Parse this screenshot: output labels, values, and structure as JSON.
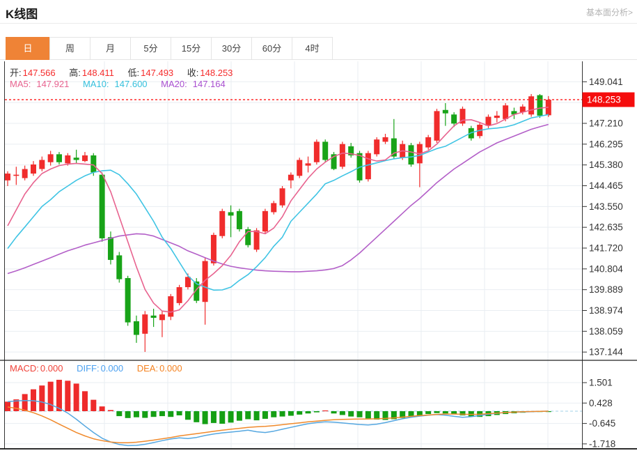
{
  "header": {
    "title": "K线图",
    "link_label": "基本面分析>"
  },
  "tabs": {
    "items": [
      {
        "key": "day",
        "label": "日",
        "active": true
      },
      {
        "key": "week",
        "label": "周",
        "active": false
      },
      {
        "key": "month",
        "label": "月",
        "active": false
      },
      {
        "key": "5min",
        "label": "5分",
        "active": false
      },
      {
        "key": "15min",
        "label": "15分",
        "active": false
      },
      {
        "key": "30min",
        "label": "30分",
        "active": false
      },
      {
        "key": "60min",
        "label": "60分",
        "active": false
      },
      {
        "key": "4hour",
        "label": "4时",
        "active": false
      }
    ]
  },
  "legend": {
    "open_label": "开:",
    "open": "147.566",
    "high_label": "高:",
    "high": "148.411",
    "low_label": "低:",
    "low": "147.493",
    "close_label": "收:",
    "close": "148.253",
    "ma5_label": "MA5:",
    "ma5": "147.921",
    "ma10_label": "MA10:",
    "ma10": "147.600",
    "ma20_label": "MA20:",
    "ma20": "147.164",
    "macd_label": "MACD:",
    "macd": "0.000",
    "diff_label": "DIFF:",
    "diff": "0.000",
    "dea_label": "DEA:",
    "dea": "0.000"
  },
  "colors": {
    "up": "#f02c2c",
    "down": "#18a318",
    "ma5": "#e8638f",
    "ma10": "#3fc4e4",
    "ma20": "#b35fc8",
    "hist_up": "#ee2b2b",
    "hist_down": "#149f14",
    "diff_line": "#55a7e0",
    "dea_line": "#f08a2c",
    "price_line": "#ff2a2a",
    "price_box_bg": "#f50d0d",
    "price_box_text": "#ffffff",
    "grid": "#e9eef2",
    "axis_line": "#333333",
    "axis_text": "#333333",
    "macd_zero": "#b5d9ec",
    "tab_active_bg": "#ef8336"
  },
  "chart_data": [
    {
      "type": "candlestick",
      "pane": "price",
      "ylim": [
        136.9,
        149.35
      ],
      "y_tick_labels": [
        "149.041",
        "147.210",
        "146.295",
        "145.380",
        "144.465",
        "143.550",
        "142.635",
        "141.720",
        "140.804",
        "139.889",
        "138.974",
        "138.059",
        "137.144"
      ],
      "y_grid_extra": [
        148.126
      ],
      "current_price": 148.253,
      "current_price_label": "148.253",
      "candles_format": [
        "open",
        "high",
        "low",
        "close"
      ],
      "candles": [
        [
          144.7,
          145.1,
          144.45,
          145.0
        ],
        [
          144.9,
          145.3,
          144.5,
          144.95
        ],
        [
          144.8,
          145.35,
          144.7,
          145.2
        ],
        [
          145.0,
          145.55,
          144.9,
          145.4
        ],
        [
          145.2,
          145.75,
          145.1,
          145.6
        ],
        [
          145.5,
          146.0,
          145.35,
          145.85
        ],
        [
          145.85,
          145.95,
          145.4,
          145.5
        ],
        [
          145.45,
          145.9,
          145.35,
          145.8
        ],
        [
          145.7,
          146.05,
          145.45,
          145.6
        ],
        [
          145.55,
          145.95,
          145.5,
          145.8
        ],
        [
          145.8,
          145.9,
          144.9,
          145.05
        ],
        [
          144.95,
          145.05,
          142.0,
          142.15
        ],
        [
          142.2,
          142.45,
          141.0,
          141.2
        ],
        [
          141.4,
          141.55,
          140.2,
          140.35
        ],
        [
          140.4,
          140.5,
          138.3,
          138.45
        ],
        [
          138.5,
          138.75,
          137.55,
          137.9
        ],
        [
          137.95,
          138.95,
          137.15,
          138.8
        ],
        [
          138.75,
          139.05,
          138.25,
          138.65
        ],
        [
          138.55,
          138.95,
          137.8,
          138.8
        ],
        [
          138.7,
          139.7,
          138.55,
          139.6
        ],
        [
          139.3,
          140.1,
          139.2,
          140.0
        ],
        [
          140.0,
          140.6,
          139.9,
          140.45
        ],
        [
          140.25,
          140.4,
          139.3,
          139.4
        ],
        [
          139.35,
          141.3,
          138.35,
          141.15
        ],
        [
          141.05,
          142.4,
          140.95,
          142.3
        ],
        [
          142.25,
          143.45,
          142.15,
          143.35
        ],
        [
          143.3,
          143.6,
          142.2,
          143.15
        ],
        [
          143.35,
          143.45,
          142.45,
          142.55
        ],
        [
          142.55,
          142.65,
          141.75,
          141.85
        ],
        [
          141.65,
          142.6,
          141.55,
          142.5
        ],
        [
          142.45,
          143.45,
          142.35,
          143.35
        ],
        [
          143.3,
          143.8,
          143.2,
          143.7
        ],
        [
          143.6,
          144.45,
          143.5,
          144.35
        ],
        [
          144.7,
          145.05,
          144.35,
          144.95
        ],
        [
          144.9,
          145.7,
          144.8,
          145.6
        ],
        [
          145.35,
          145.75,
          145.05,
          145.45
        ],
        [
          145.5,
          146.5,
          145.4,
          146.4
        ],
        [
          146.4,
          146.5,
          145.5,
          145.6
        ],
        [
          145.85,
          145.95,
          145.15,
          145.2
        ],
        [
          145.3,
          146.4,
          145.2,
          146.3
        ],
        [
          146.2,
          146.35,
          145.7,
          145.8
        ],
        [
          145.9,
          146.0,
          144.6,
          144.7
        ],
        [
          144.75,
          146.0,
          144.65,
          145.9
        ],
        [
          145.85,
          146.6,
          145.75,
          146.5
        ],
        [
          146.4,
          146.75,
          146.3,
          146.6
        ],
        [
          146.55,
          147.4,
          145.65,
          145.75
        ],
        [
          145.7,
          146.45,
          145.6,
          146.3
        ],
        [
          146.25,
          146.35,
          145.3,
          145.4
        ],
        [
          145.45,
          146.4,
          144.4,
          146.3
        ],
        [
          146.15,
          146.7,
          146.05,
          146.6
        ],
        [
          146.45,
          147.85,
          146.35,
          147.75
        ],
        [
          147.8,
          148.1,
          147.1,
          147.65
        ],
        [
          147.6,
          147.7,
          147.05,
          147.2
        ],
        [
          147.2,
          147.95,
          147.1,
          147.85
        ],
        [
          147.0,
          147.1,
          146.45,
          146.55
        ],
        [
          146.65,
          147.25,
          146.55,
          147.15
        ],
        [
          147.1,
          147.6,
          147.0,
          147.5
        ],
        [
          147.45,
          147.75,
          147.25,
          147.55
        ],
        [
          147.4,
          148.1,
          147.3,
          148.0
        ],
        [
          147.75,
          147.9,
          147.4,
          147.6
        ],
        [
          147.7,
          148.05,
          147.6,
          147.95
        ],
        [
          147.6,
          148.5,
          147.5,
          148.4
        ],
        [
          148.45,
          148.5,
          147.45,
          147.55
        ],
        [
          147.566,
          148.411,
          147.493,
          148.253
        ]
      ],
      "series": [
        {
          "name": "MA5",
          "values": [
            142.7,
            143.4,
            144.1,
            144.6,
            145.0,
            145.2,
            145.35,
            145.42,
            145.45,
            145.42,
            145.38,
            145.0,
            144.2,
            143.1,
            142.0,
            140.9,
            139.9,
            139.3,
            138.95,
            138.9,
            139.0,
            139.4,
            139.9,
            140.3,
            140.6,
            140.95,
            141.4,
            142.0,
            142.45,
            142.45,
            142.35,
            142.6,
            143.1,
            143.8,
            144.3,
            144.8,
            145.2,
            145.5,
            145.75,
            145.9,
            145.87,
            145.8,
            145.65,
            145.55,
            145.6,
            145.9,
            146.0,
            145.95,
            145.87,
            146.0,
            146.3,
            146.7,
            147.1,
            147.35,
            147.37,
            147.25,
            147.1,
            147.2,
            147.4,
            147.6,
            147.7,
            147.8,
            147.88,
            147.921
          ]
        },
        {
          "name": "MA10",
          "values": [
            141.7,
            142.2,
            142.65,
            143.1,
            143.55,
            143.85,
            144.2,
            144.45,
            144.7,
            144.9,
            145.05,
            145.12,
            145.15,
            144.95,
            144.55,
            144.1,
            143.5,
            142.9,
            142.2,
            141.7,
            141.1,
            140.5,
            140.15,
            140.0,
            139.87,
            139.88,
            140.0,
            140.3,
            140.55,
            140.9,
            141.3,
            141.8,
            142.2,
            142.9,
            143.3,
            143.7,
            144.1,
            144.55,
            144.7,
            144.9,
            145.08,
            145.28,
            145.38,
            145.47,
            145.57,
            145.65,
            145.7,
            145.73,
            145.8,
            145.95,
            146.1,
            146.2,
            146.4,
            146.6,
            146.8,
            146.9,
            146.97,
            147.0,
            147.05,
            147.15,
            147.3,
            147.45,
            147.52,
            147.6
          ]
        },
        {
          "name": "MA20",
          "values": [
            140.6,
            140.72,
            140.85,
            141.0,
            141.15,
            141.3,
            141.45,
            141.6,
            141.72,
            141.85,
            141.95,
            142.05,
            142.15,
            142.25,
            142.3,
            142.35,
            142.33,
            142.25,
            142.1,
            141.95,
            141.8,
            141.6,
            141.45,
            141.3,
            141.15,
            141.02,
            140.92,
            140.85,
            140.8,
            140.75,
            140.72,
            140.7,
            140.69,
            140.68,
            140.68,
            140.7,
            140.72,
            140.76,
            140.82,
            140.95,
            141.2,
            141.5,
            141.85,
            142.2,
            142.55,
            142.9,
            143.25,
            143.6,
            143.9,
            144.25,
            144.6,
            144.9,
            145.2,
            145.45,
            145.7,
            145.95,
            146.15,
            146.35,
            146.5,
            146.65,
            146.8,
            146.95,
            147.06,
            147.164
          ]
        }
      ]
    },
    {
      "type": "bar",
      "pane": "macd",
      "ylim": [
        -1.9,
        1.75
      ],
      "y_tick_labels": [
        "1.501",
        "0.428",
        "-0.645",
        "-1.718"
      ],
      "zero_line": 0,
      "histogram": [
        0.5,
        0.62,
        0.9,
        1.15,
        1.35,
        1.55,
        1.65,
        1.6,
        1.45,
        1.05,
        0.6,
        0.25,
        0.06,
        -0.26,
        -0.36,
        -0.32,
        -0.35,
        -0.3,
        -0.26,
        -0.3,
        -0.22,
        -0.45,
        -0.58,
        -0.68,
        -0.62,
        -0.66,
        -0.6,
        -0.5,
        -0.42,
        -0.48,
        -0.4,
        -0.32,
        -0.28,
        -0.24,
        -0.18,
        -0.12,
        -0.06,
        0.04,
        -0.12,
        -0.2,
        -0.28,
        -0.32,
        -0.38,
        -0.44,
        -0.46,
        -0.42,
        -0.36,
        -0.3,
        -0.22,
        -0.15,
        -0.1,
        -0.12,
        -0.16,
        -0.22,
        -0.28,
        -0.3,
        -0.26,
        -0.2,
        -0.15,
        -0.11,
        -0.08,
        -0.05,
        -0.03,
        -0.01
      ],
      "series": [
        {
          "name": "DIFF",
          "values": [
            0.5,
            0.54,
            0.56,
            0.55,
            0.48,
            0.35,
            0.15,
            -0.1,
            -0.42,
            -0.78,
            -1.12,
            -1.42,
            -1.62,
            -1.75,
            -1.81,
            -1.8,
            -1.74,
            -1.65,
            -1.55,
            -1.46,
            -1.4,
            -1.44,
            -1.38,
            -1.28,
            -1.2,
            -1.14,
            -1.1,
            -1.05,
            -1.0,
            -1.08,
            -1.12,
            -1.05,
            -0.95,
            -0.85,
            -0.75,
            -0.66,
            -0.6,
            -0.56,
            -0.58,
            -0.62,
            -0.66,
            -0.7,
            -0.72,
            -0.68,
            -0.6,
            -0.5,
            -0.4,
            -0.32,
            -0.26,
            -0.21,
            -0.18,
            -0.21,
            -0.27,
            -0.32,
            -0.29,
            -0.23,
            -0.16,
            -0.11,
            -0.07,
            -0.05,
            -0.04,
            -0.03,
            -0.01,
            0.0
          ]
        },
        {
          "name": "DEA",
          "values": [
            0.22,
            0.15,
            0.05,
            -0.08,
            -0.25,
            -0.45,
            -0.68,
            -0.9,
            -1.12,
            -1.3,
            -1.45,
            -1.55,
            -1.62,
            -1.66,
            -1.66,
            -1.63,
            -1.58,
            -1.52,
            -1.45,
            -1.38,
            -1.3,
            -1.24,
            -1.18,
            -1.12,
            -1.06,
            -1.0,
            -0.95,
            -0.9,
            -0.85,
            -0.82,
            -0.8,
            -0.76,
            -0.71,
            -0.66,
            -0.61,
            -0.56,
            -0.52,
            -0.48,
            -0.45,
            -0.43,
            -0.42,
            -0.41,
            -0.41,
            -0.4,
            -0.38,
            -0.35,
            -0.31,
            -0.27,
            -0.23,
            -0.2,
            -0.17,
            -0.15,
            -0.15,
            -0.16,
            -0.17,
            -0.16,
            -0.13,
            -0.1,
            -0.07,
            -0.05,
            -0.03,
            -0.02,
            -0.01,
            0.0
          ]
        }
      ]
    }
  ]
}
